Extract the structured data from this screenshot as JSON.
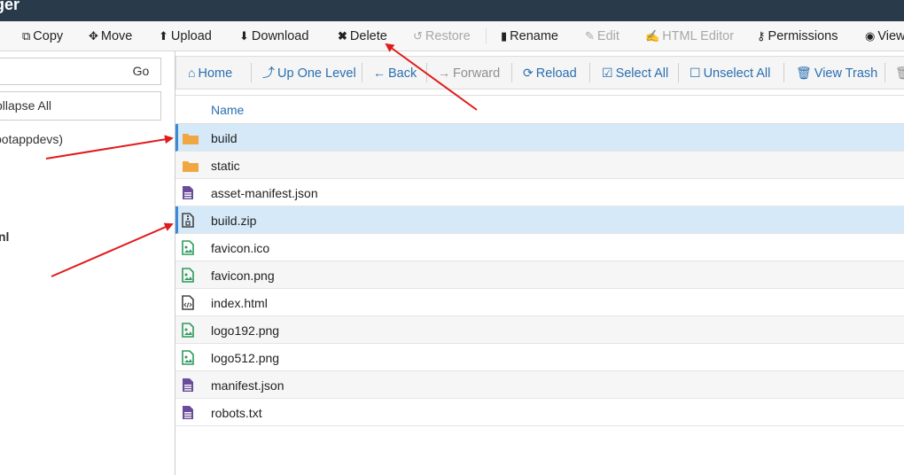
{
  "window": {
    "title_fragment": "ger"
  },
  "toolbar": {
    "copy": "Copy",
    "move": "Move",
    "upload": "Upload",
    "download": "Download",
    "delete": "Delete",
    "restore": "Restore",
    "rename": "Rename",
    "edit": "Edit",
    "html_editor": "HTML Editor",
    "permissions": "Permissions",
    "view": "View"
  },
  "sidebar": {
    "go_label": "Go",
    "collapse_label": "ollapse All",
    "tree_root_label": "botappdevs)",
    "tree_fragment": "nl"
  },
  "navbar": {
    "home": "Home",
    "up_one_level": "Up One Level",
    "back": "Back",
    "forward": "Forward",
    "reload": "Reload",
    "select_all": "Select All",
    "unselect_all": "Unselect All",
    "view_trash": "View Trash"
  },
  "table": {
    "header_name": "Name",
    "files": [
      {
        "name": "build",
        "type": "folder",
        "selected": true
      },
      {
        "name": "static",
        "type": "folder",
        "selected": false
      },
      {
        "name": "asset-manifest.json",
        "type": "text",
        "selected": false
      },
      {
        "name": "build.zip",
        "type": "zip",
        "selected": true
      },
      {
        "name": "favicon.ico",
        "type": "image",
        "selected": false
      },
      {
        "name": "favicon.png",
        "type": "image",
        "selected": false
      },
      {
        "name": "index.html",
        "type": "code",
        "selected": false
      },
      {
        "name": "logo192.png",
        "type": "image",
        "selected": false
      },
      {
        "name": "logo512.png",
        "type": "image",
        "selected": false
      },
      {
        "name": "manifest.json",
        "type": "text",
        "selected": false
      },
      {
        "name": "robots.txt",
        "type": "text",
        "selected": false
      }
    ]
  },
  "colors": {
    "titlebar": "#293a4a",
    "link_blue": "#2a6fb0",
    "selected_row": "#d6e9f8",
    "folder": "#f0a742",
    "text_file": "#6b4c9a",
    "image_file": "#2e9a5c",
    "annotation_arrow": "#e01b1b"
  },
  "icons": {
    "copy": "copy-icon",
    "move": "move-arrows-icon",
    "upload": "upload-icon",
    "download": "download-icon",
    "delete": "x-icon",
    "restore": "undo-icon",
    "rename": "file-icon",
    "edit": "pencil-icon",
    "html_editor": "edit-square-icon",
    "permissions": "key-icon",
    "view": "eye-icon",
    "home": "home-icon",
    "up": "level-up-icon",
    "back": "arrow-left-icon",
    "forward": "arrow-right-icon",
    "reload": "refresh-icon",
    "select_all": "checkbox-checked-icon",
    "unselect_all": "checkbox-empty-icon",
    "trash": "trash-icon"
  }
}
